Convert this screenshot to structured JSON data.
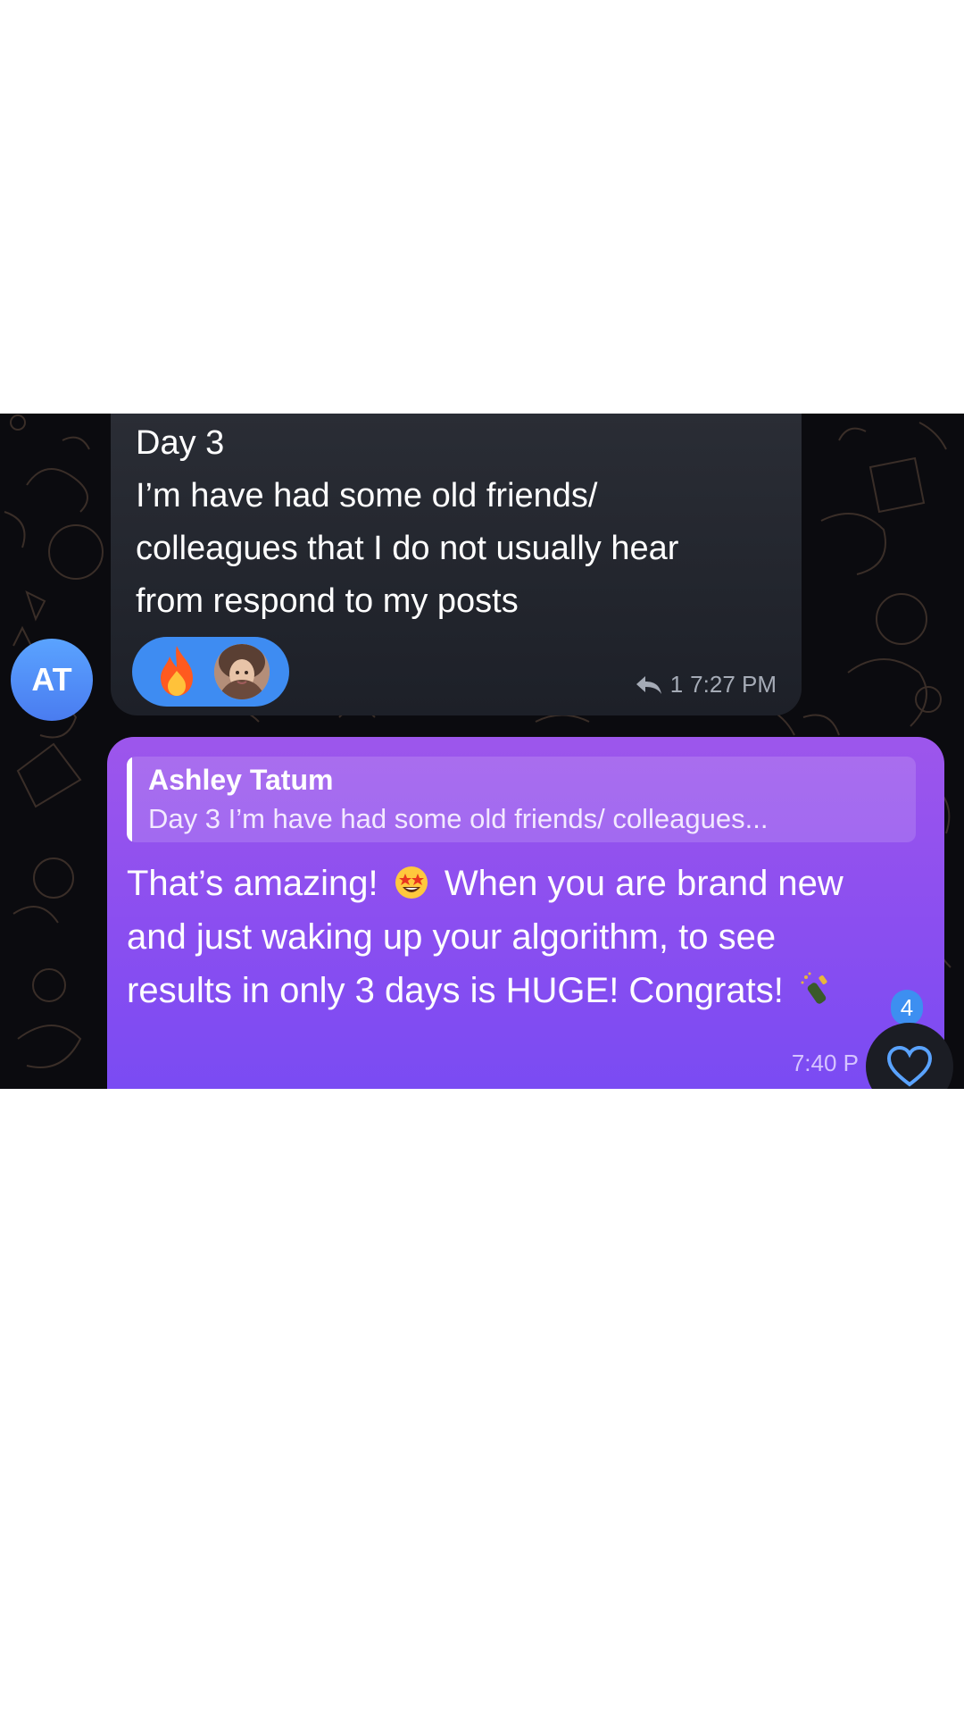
{
  "incoming": {
    "avatar_initials": "AT",
    "avatar_color": "#4a7cf0",
    "text": "Day 3\nI’m have had some old friends/\ncolleagues that I do not usually hear\nfrom respond to my posts",
    "reactions": [
      {
        "icon": "fire-icon"
      },
      {
        "icon": "user-avatar-reaction"
      }
    ],
    "reply_count": "1",
    "time": "7:27 PM"
  },
  "outgoing": {
    "quote": {
      "author": "Ashley Tatum",
      "text": "Day 3 I’m have had some old friends/ colleagues..."
    },
    "text_part1": "That’s amazing!",
    "text_part2": "When you are brand new and just waking up your algorithm, to see results in only 3 days is HUGE! Congrats!",
    "emoji_1": "star-struck-emoji",
    "emoji_2": "champagne-emoji",
    "time": "7:40 P",
    "bubble_color": "#8a4ef0"
  },
  "like": {
    "count": "4",
    "icon": "heart-icon"
  }
}
